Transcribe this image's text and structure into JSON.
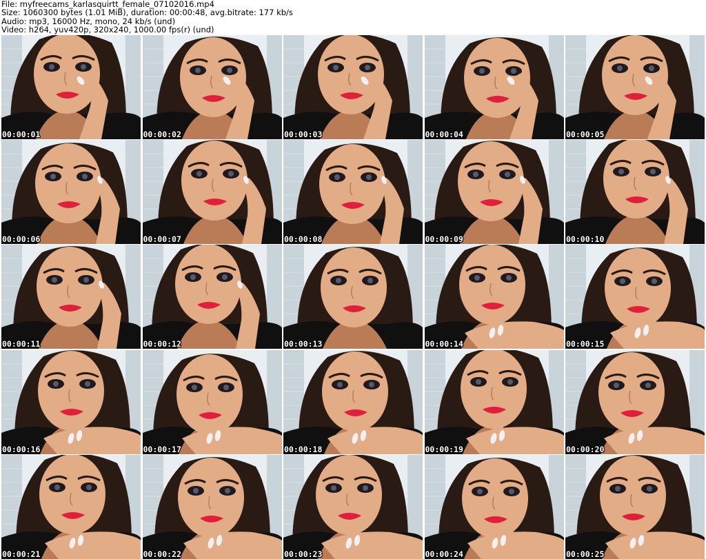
{
  "header": {
    "file_line": "File: myfreecams_karlasquirtt_female_07102016.mp4",
    "size_line": "Size: 1060300 bytes (1.01 MiB), duration: 00:00:48, avg.bitrate: 177 kb/s",
    "audio_line": "Audio: mp3, 16000 Hz, mono, 24 kb/s (und)",
    "video_line": "Video: h264, yuv420p, 320x240, 1000.00 fps(r) (und)"
  },
  "thumbnails": [
    {
      "timestamp": "00:00:01",
      "pose": "hand-cheek"
    },
    {
      "timestamp": "00:00:02",
      "pose": "hand-cheek"
    },
    {
      "timestamp": "00:00:03",
      "pose": "hand-cheek"
    },
    {
      "timestamp": "00:00:04",
      "pose": "hand-cheek"
    },
    {
      "timestamp": "00:00:05",
      "pose": "hand-cheek"
    },
    {
      "timestamp": "00:00:06",
      "pose": "hand-neck"
    },
    {
      "timestamp": "00:00:07",
      "pose": "hand-neck"
    },
    {
      "timestamp": "00:00:08",
      "pose": "hand-jaw"
    },
    {
      "timestamp": "00:00:09",
      "pose": "hand-jaw"
    },
    {
      "timestamp": "00:00:10",
      "pose": "hand-jaw"
    },
    {
      "timestamp": "00:00:11",
      "pose": "hand-jaw"
    },
    {
      "timestamp": "00:00:12",
      "pose": "hand-jaw"
    },
    {
      "timestamp": "00:00:13",
      "pose": "head-down"
    },
    {
      "timestamp": "00:00:14",
      "pose": "hand-chin"
    },
    {
      "timestamp": "00:00:15",
      "pose": "hand-chin"
    },
    {
      "timestamp": "00:00:16",
      "pose": "hand-chin"
    },
    {
      "timestamp": "00:00:17",
      "pose": "hand-chin"
    },
    {
      "timestamp": "00:00:18",
      "pose": "hand-chin"
    },
    {
      "timestamp": "00:00:19",
      "pose": "hand-chin"
    },
    {
      "timestamp": "00:00:20",
      "pose": "hand-chin"
    },
    {
      "timestamp": "00:00:21",
      "pose": "hand-chin"
    },
    {
      "timestamp": "00:00:22",
      "pose": "hand-chin"
    },
    {
      "timestamp": "00:00:23",
      "pose": "hand-chin"
    },
    {
      "timestamp": "00:00:24",
      "pose": "hand-chin"
    },
    {
      "timestamp": "00:00:25",
      "pose": "hand-chin"
    }
  ],
  "colors": {
    "skin": "#e2ad86",
    "skin_shadow": "#b97c57",
    "hair": "#2a1a14",
    "lips": "#e0203a",
    "eyes": "#1e1a20",
    "top": "#101010",
    "background_light": "#e8eef2",
    "background_blind": "#c9d3da",
    "nails": "#f4f0f2"
  }
}
